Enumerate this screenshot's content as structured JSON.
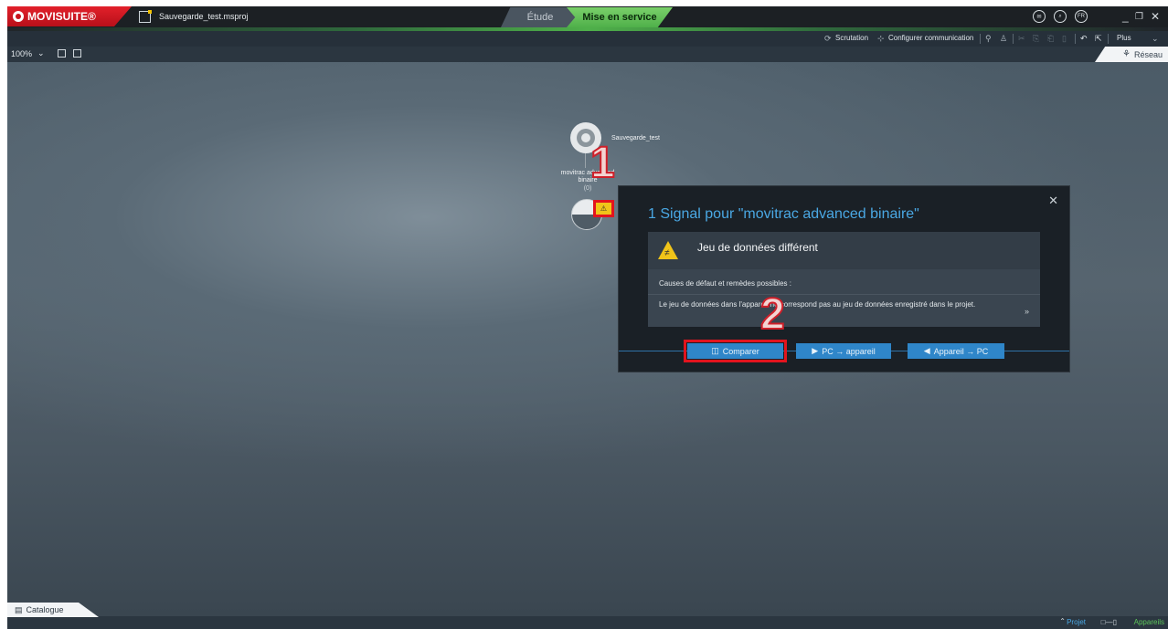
{
  "app": {
    "logo_text": "MOVISUITE®",
    "project_file": "Sauvegarde_test.msproj",
    "tabs": [
      "Étude",
      "Mise en service"
    ],
    "lang": "FR"
  },
  "toolbar": {
    "scrutation": "Scrutation",
    "configure": "Configurer communication",
    "plus": "Plus"
  },
  "zoom": {
    "value": "100%"
  },
  "network_tab": "Réseau",
  "tree": {
    "root_name": "Sauvegarde_test",
    "device_name": "movitrac advanced binaire",
    "device_address": "(0)"
  },
  "callouts": [
    "1",
    "2"
  ],
  "popup": {
    "title": "1 Signal pour \"movitrac advanced binaire\"",
    "message_title": "Jeu de données différent",
    "causes_label": "Causes de défaut et remèdes possibles :",
    "detail": "Le jeu de données dans l'appareil ne correspond pas au jeu de données enregistré dans le projet.",
    "buttons": {
      "compare": "Comparer",
      "pc_to_device": "PC → appareil",
      "device_to_pc": "Appareil → PC"
    }
  },
  "bottom": {
    "catalogue": "Catalogue",
    "projet": "Projet",
    "appareils": "Appareils"
  },
  "colors": {
    "accent_green": "#4fb04a",
    "accent_blue": "#2f86c9",
    "brand_red": "#e2202a",
    "highlight_red": "#e2141e",
    "warning_yellow": "#f0c419"
  }
}
